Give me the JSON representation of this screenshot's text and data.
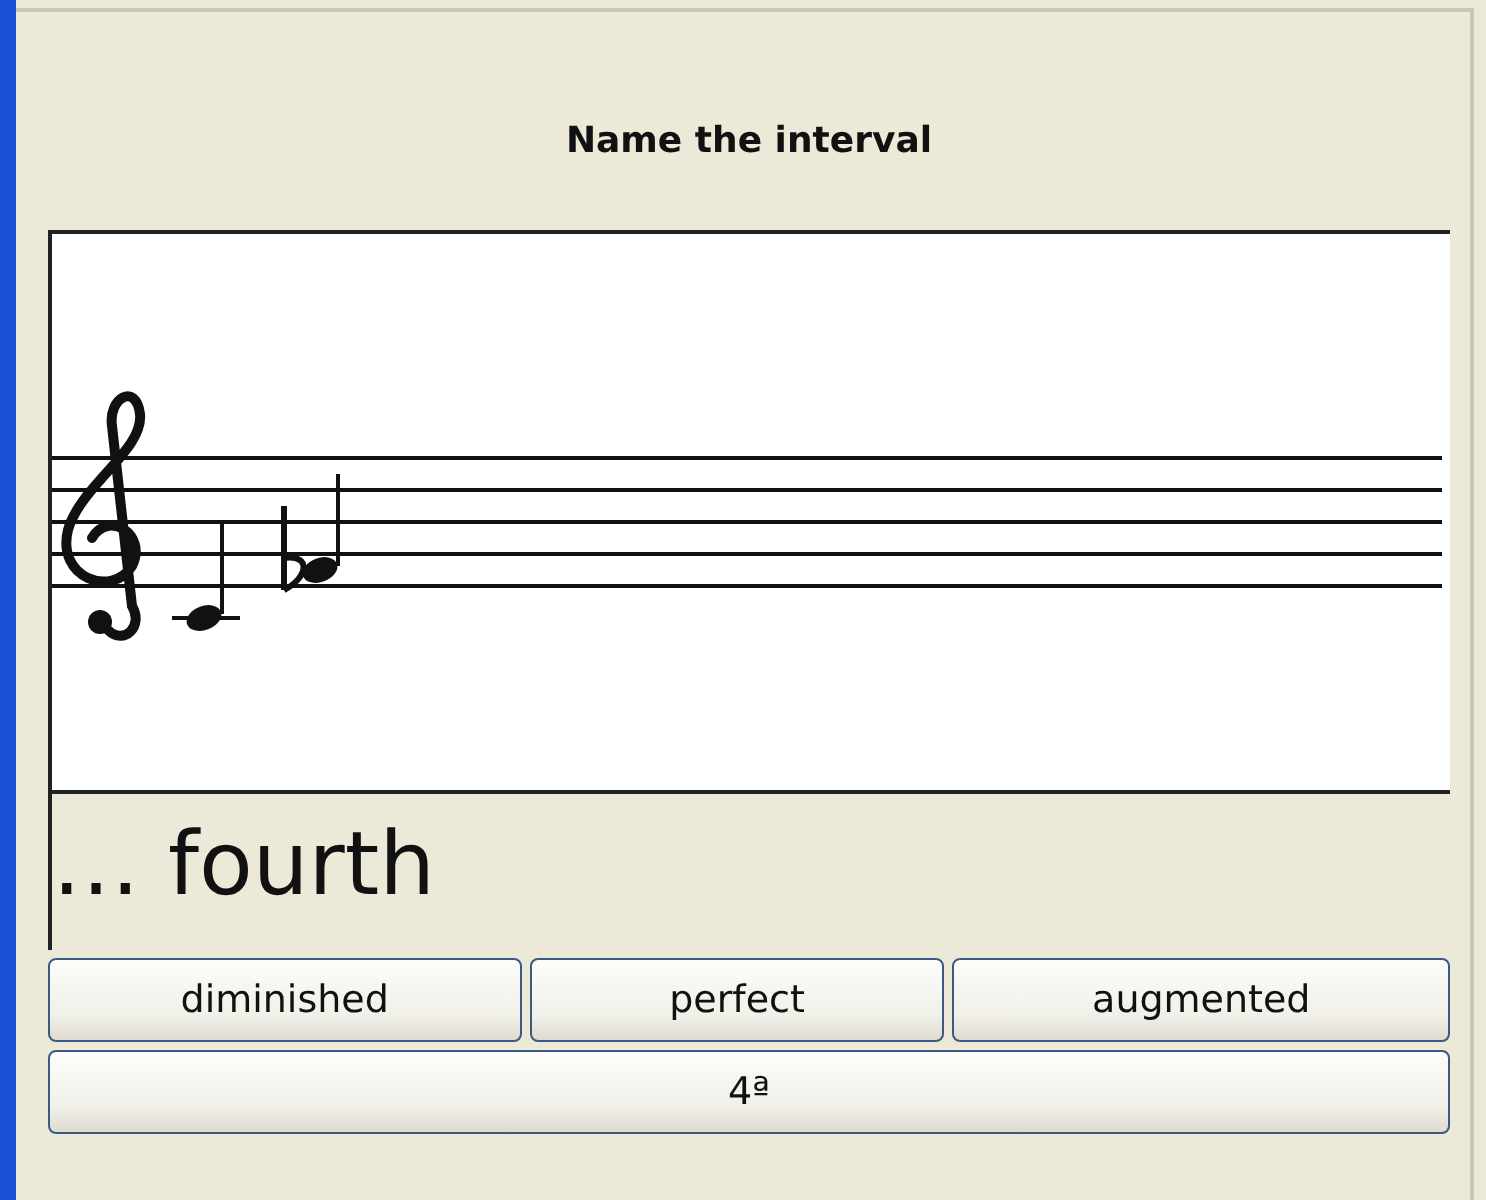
{
  "title": "Name the interval",
  "answer": "… fourth",
  "quality_buttons": [
    {
      "label": "diminished"
    },
    {
      "label": "perfect"
    },
    {
      "label": "augmented"
    }
  ],
  "abbreviation_button": {
    "label": "4ª"
  }
}
